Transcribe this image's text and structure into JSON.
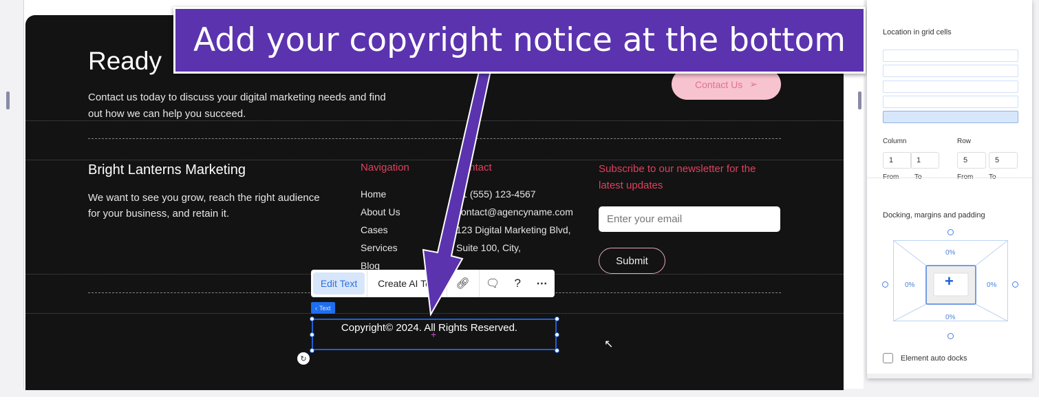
{
  "callout": {
    "text": "Add your copyright notice at the bottom",
    "color": "#5b33ae"
  },
  "hero": {
    "title": "Ready",
    "body_line1": "Contact us today to discuss your digital marketing needs and find",
    "body_line2": "out how we can help you succeed.",
    "cta": "Contact Us",
    "cta_icon": "send-icon"
  },
  "footer": {
    "brand": "Bright Lanterns Marketing",
    "tagline_line1": "We want to see you grow, reach the right audience",
    "tagline_line2": "for your business, and retain it.",
    "nav_heading": "Navigation",
    "nav_items": [
      "Home",
      "About Us",
      "Cases",
      "Services",
      "Blog"
    ],
    "contact_heading": "Contact",
    "contact_items": [
      "+1 (555) 123-4567",
      "contact@agencyname.com",
      "123 Digital Marketing Blvd,",
      "Suite 100, City,"
    ],
    "newsletter_line1": "Subscribe to our newsletter for the",
    "newsletter_line2": "latest updates",
    "email_placeholder": "Enter your email",
    "submit": "Submit",
    "copyright": "Copyright© 2024. All Rights Reserved.",
    "accent": "#e0405f"
  },
  "toolbar": {
    "edit_text": "Edit Text",
    "create_ai": "Create AI Text",
    "tag": "Text"
  },
  "panel": {
    "location_label": "Location in grid cells",
    "column_label": "Column",
    "row_label": "Row",
    "col_from": "1",
    "col_to": "1",
    "row_from": "5",
    "row_to": "5",
    "from_label": "From",
    "to_label": "To",
    "docking_label": "Docking, margins and padding",
    "margin_top": "0%",
    "margin_left": "0%",
    "margin_right": "0%",
    "margin_bottom": "0%",
    "auto_docks_label": "Element auto docks",
    "auto_docks_checked": false
  }
}
